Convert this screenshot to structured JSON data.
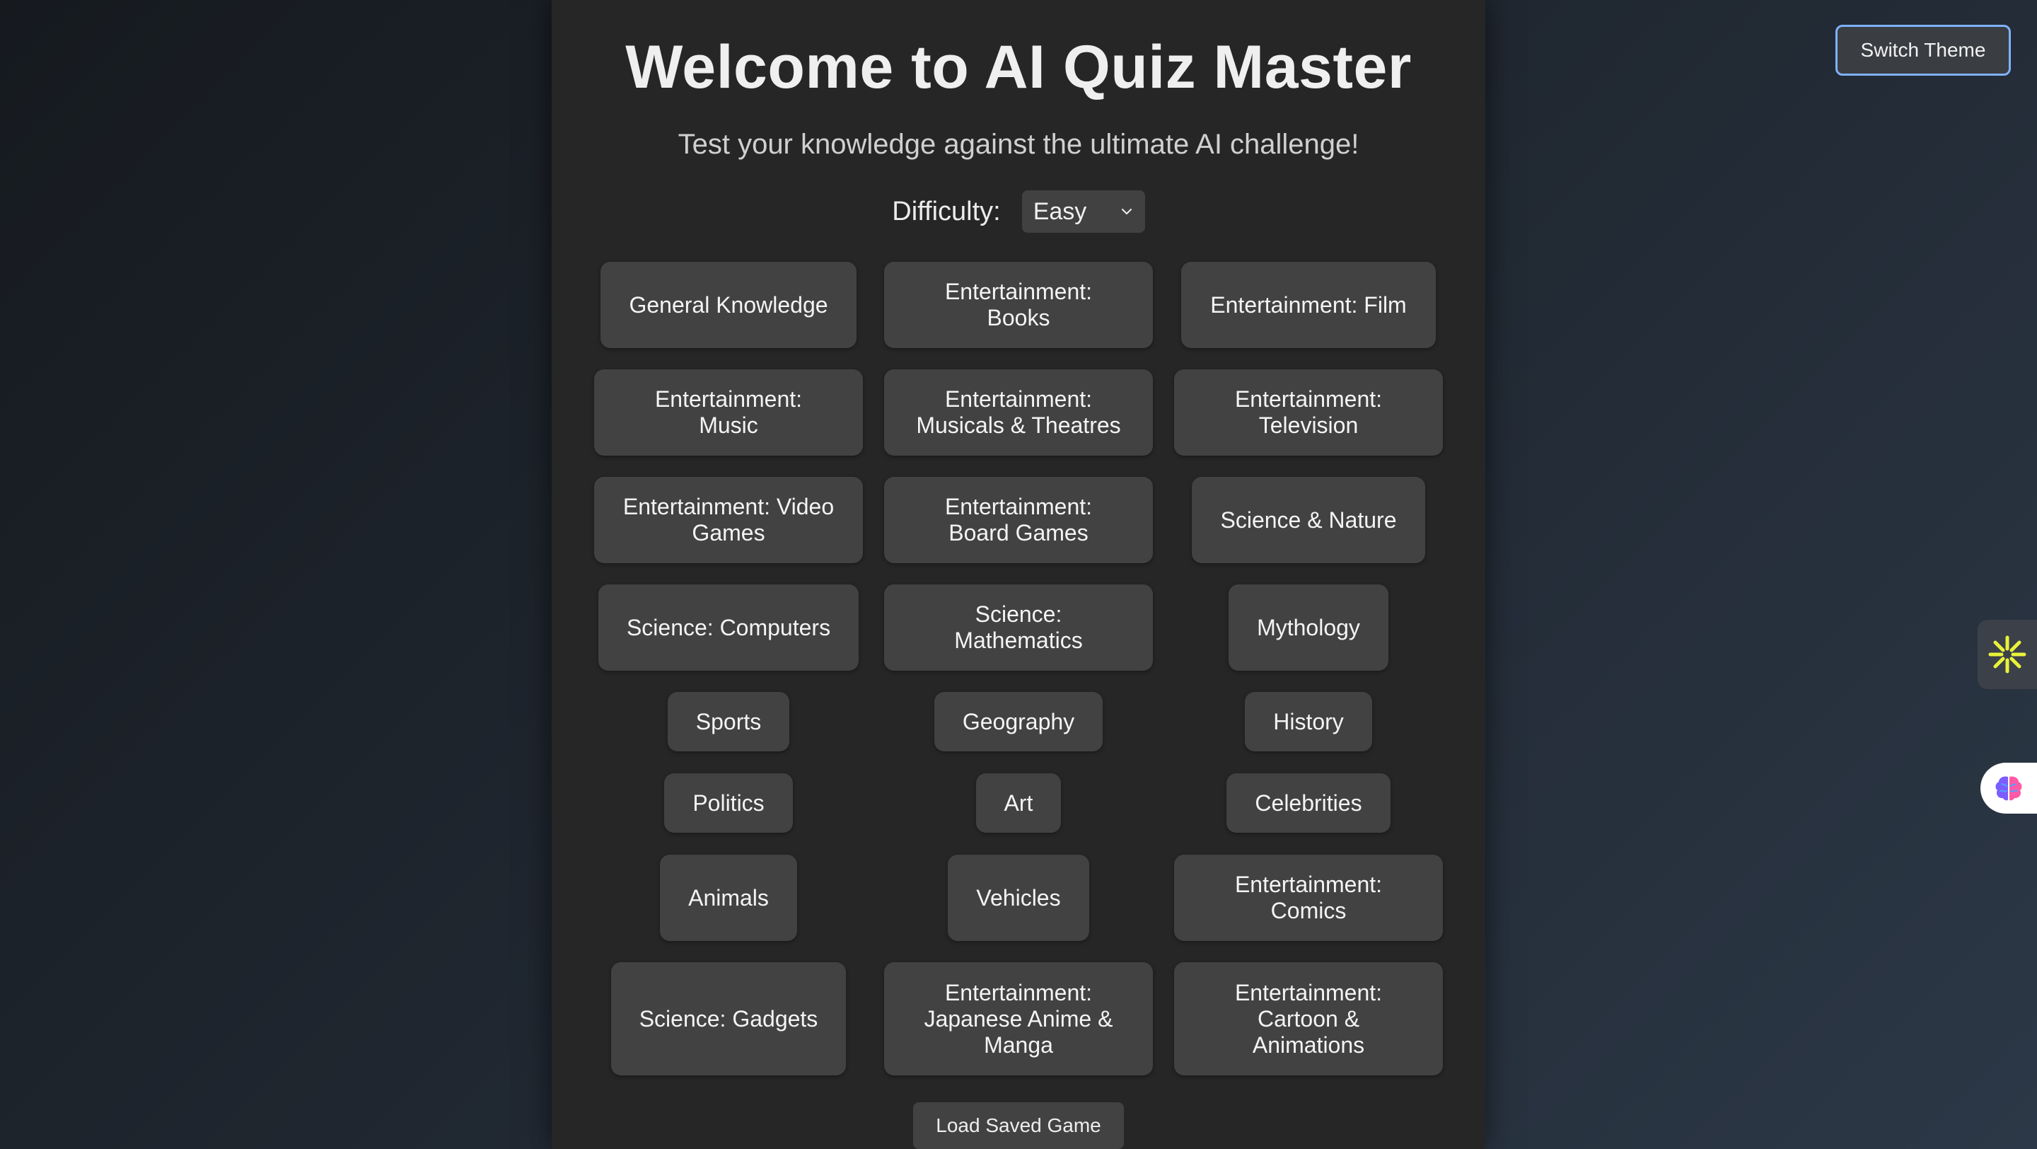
{
  "header": {
    "title": "Welcome to AI Quiz Master",
    "subtitle": "Test your knowledge against the ultimate AI challenge!"
  },
  "difficulty": {
    "label": "Difficulty:",
    "selected": "Easy"
  },
  "categories": [
    [
      "General Knowledge",
      "Entertainment:\nBooks",
      "Entertainment: Film"
    ],
    [
      "Entertainment:\nMusic",
      "Entertainment:\nMusicals & Theatres",
      "Entertainment:\nTelevision"
    ],
    [
      "Entertainment: Video\nGames",
      "Entertainment:\nBoard Games",
      "Science & Nature"
    ],
    [
      "Science: Computers",
      "Science:\nMathematics",
      "Mythology"
    ],
    [
      "Sports",
      "Geography",
      "History"
    ],
    [
      "Politics",
      "Art",
      "Celebrities"
    ],
    [
      "Animals",
      "Vehicles",
      "Entertainment:\nComics"
    ],
    [
      "Science: Gadgets",
      "Entertainment:\nJapanese Anime &\nManga",
      "Entertainment:\nCartoon &\nAnimations"
    ]
  ],
  "load_game_label": "Load Saved Game",
  "theme_button_label": "Switch Theme",
  "side_extensions": [
    {
      "icon": "sparkle-icon",
      "color": "#e8f23a"
    },
    {
      "icon": "brain-icon",
      "colors": [
        "#7b5cff",
        "#ff5aa8",
        "#4da3ff"
      ]
    }
  ],
  "colors": {
    "panel": "#262626",
    "button": "#424242",
    "focus_outline": "#7fb2ff"
  }
}
